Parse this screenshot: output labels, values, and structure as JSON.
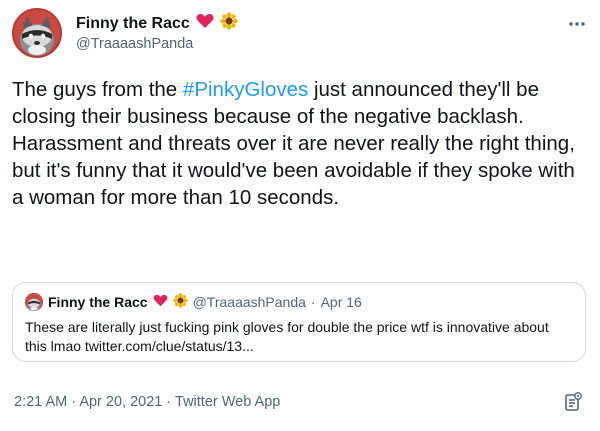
{
  "author": {
    "display_name": "Finny the Racc",
    "handle": "@TraaaashPanda",
    "emojis": [
      "red-heart",
      "sunflower"
    ]
  },
  "tweet": {
    "text_before": "The guys from the ",
    "hashtag": "#PinkyGloves",
    "text_after": " just announced they'll be closing their business because of the negative backlash.\nHarassment and threats over it are never really the right thing, but it's funny that it would've been avoidable if they spoke with a woman for more than 10 seconds."
  },
  "quoted_tweet": {
    "display_name": "Finny the Racc",
    "handle": "@TraaaashPanda",
    "date": "Apr 16",
    "separator": "·",
    "text": "These are literally just fucking pink gloves for double the price wtf is innovative about this lmao twitter.com/clue/status/13..."
  },
  "footer": {
    "time": "2:21 AM",
    "separator": "·",
    "date": "Apr 20, 2021",
    "source": "Twitter Web App"
  },
  "icons": {
    "more": "more-horizontal-icon",
    "analytics": "analytics-icon"
  },
  "colors": {
    "link": "#1d9bf0",
    "secondary_text": "#536471",
    "border": "#cfd9de",
    "heart": "#e0245e",
    "sunflower": "#f4b400"
  }
}
